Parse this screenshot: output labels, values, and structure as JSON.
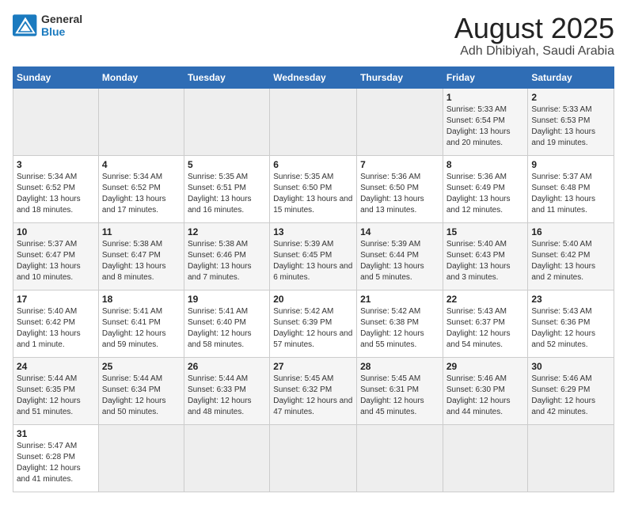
{
  "header": {
    "logo_general": "General",
    "logo_blue": "Blue",
    "month_title": "August 2025",
    "location": "Adh Dhibiyah, Saudi Arabia"
  },
  "weekdays": [
    "Sunday",
    "Monday",
    "Tuesday",
    "Wednesday",
    "Thursday",
    "Friday",
    "Saturday"
  ],
  "weeks": [
    [
      {
        "day": "",
        "info": ""
      },
      {
        "day": "",
        "info": ""
      },
      {
        "day": "",
        "info": ""
      },
      {
        "day": "",
        "info": ""
      },
      {
        "day": "",
        "info": ""
      },
      {
        "day": "1",
        "info": "Sunrise: 5:33 AM\nSunset: 6:54 PM\nDaylight: 13 hours and 20 minutes."
      },
      {
        "day": "2",
        "info": "Sunrise: 5:33 AM\nSunset: 6:53 PM\nDaylight: 13 hours and 19 minutes."
      }
    ],
    [
      {
        "day": "3",
        "info": "Sunrise: 5:34 AM\nSunset: 6:52 PM\nDaylight: 13 hours and 18 minutes."
      },
      {
        "day": "4",
        "info": "Sunrise: 5:34 AM\nSunset: 6:52 PM\nDaylight: 13 hours and 17 minutes."
      },
      {
        "day": "5",
        "info": "Sunrise: 5:35 AM\nSunset: 6:51 PM\nDaylight: 13 hours and 16 minutes."
      },
      {
        "day": "6",
        "info": "Sunrise: 5:35 AM\nSunset: 6:50 PM\nDaylight: 13 hours and 15 minutes."
      },
      {
        "day": "7",
        "info": "Sunrise: 5:36 AM\nSunset: 6:50 PM\nDaylight: 13 hours and 13 minutes."
      },
      {
        "day": "8",
        "info": "Sunrise: 5:36 AM\nSunset: 6:49 PM\nDaylight: 13 hours and 12 minutes."
      },
      {
        "day": "9",
        "info": "Sunrise: 5:37 AM\nSunset: 6:48 PM\nDaylight: 13 hours and 11 minutes."
      }
    ],
    [
      {
        "day": "10",
        "info": "Sunrise: 5:37 AM\nSunset: 6:47 PM\nDaylight: 13 hours and 10 minutes."
      },
      {
        "day": "11",
        "info": "Sunrise: 5:38 AM\nSunset: 6:47 PM\nDaylight: 13 hours and 8 minutes."
      },
      {
        "day": "12",
        "info": "Sunrise: 5:38 AM\nSunset: 6:46 PM\nDaylight: 13 hours and 7 minutes."
      },
      {
        "day": "13",
        "info": "Sunrise: 5:39 AM\nSunset: 6:45 PM\nDaylight: 13 hours and 6 minutes."
      },
      {
        "day": "14",
        "info": "Sunrise: 5:39 AM\nSunset: 6:44 PM\nDaylight: 13 hours and 5 minutes."
      },
      {
        "day": "15",
        "info": "Sunrise: 5:40 AM\nSunset: 6:43 PM\nDaylight: 13 hours and 3 minutes."
      },
      {
        "day": "16",
        "info": "Sunrise: 5:40 AM\nSunset: 6:42 PM\nDaylight: 13 hours and 2 minutes."
      }
    ],
    [
      {
        "day": "17",
        "info": "Sunrise: 5:40 AM\nSunset: 6:42 PM\nDaylight: 13 hours and 1 minute."
      },
      {
        "day": "18",
        "info": "Sunrise: 5:41 AM\nSunset: 6:41 PM\nDaylight: 12 hours and 59 minutes."
      },
      {
        "day": "19",
        "info": "Sunrise: 5:41 AM\nSunset: 6:40 PM\nDaylight: 12 hours and 58 minutes."
      },
      {
        "day": "20",
        "info": "Sunrise: 5:42 AM\nSunset: 6:39 PM\nDaylight: 12 hours and 57 minutes."
      },
      {
        "day": "21",
        "info": "Sunrise: 5:42 AM\nSunset: 6:38 PM\nDaylight: 12 hours and 55 minutes."
      },
      {
        "day": "22",
        "info": "Sunrise: 5:43 AM\nSunset: 6:37 PM\nDaylight: 12 hours and 54 minutes."
      },
      {
        "day": "23",
        "info": "Sunrise: 5:43 AM\nSunset: 6:36 PM\nDaylight: 12 hours and 52 minutes."
      }
    ],
    [
      {
        "day": "24",
        "info": "Sunrise: 5:44 AM\nSunset: 6:35 PM\nDaylight: 12 hours and 51 minutes."
      },
      {
        "day": "25",
        "info": "Sunrise: 5:44 AM\nSunset: 6:34 PM\nDaylight: 12 hours and 50 minutes."
      },
      {
        "day": "26",
        "info": "Sunrise: 5:44 AM\nSunset: 6:33 PM\nDaylight: 12 hours and 48 minutes."
      },
      {
        "day": "27",
        "info": "Sunrise: 5:45 AM\nSunset: 6:32 PM\nDaylight: 12 hours and 47 minutes."
      },
      {
        "day": "28",
        "info": "Sunrise: 5:45 AM\nSunset: 6:31 PM\nDaylight: 12 hours and 45 minutes."
      },
      {
        "day": "29",
        "info": "Sunrise: 5:46 AM\nSunset: 6:30 PM\nDaylight: 12 hours and 44 minutes."
      },
      {
        "day": "30",
        "info": "Sunrise: 5:46 AM\nSunset: 6:29 PM\nDaylight: 12 hours and 42 minutes."
      }
    ],
    [
      {
        "day": "31",
        "info": "Sunrise: 5:47 AM\nSunset: 6:28 PM\nDaylight: 12 hours and 41 minutes."
      },
      {
        "day": "",
        "info": ""
      },
      {
        "day": "",
        "info": ""
      },
      {
        "day": "",
        "info": ""
      },
      {
        "day": "",
        "info": ""
      },
      {
        "day": "",
        "info": ""
      },
      {
        "day": "",
        "info": ""
      }
    ]
  ]
}
